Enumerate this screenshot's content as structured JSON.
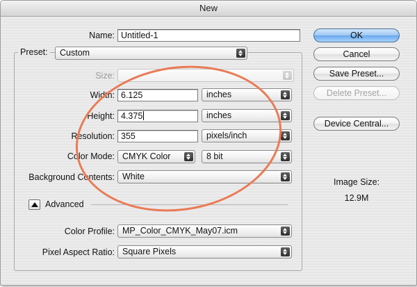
{
  "window": {
    "title": "New"
  },
  "form": {
    "name_label": "Name:",
    "name_value": "Untitled-1",
    "preset_label": "Preset:",
    "preset_value": "Custom",
    "size_label": "Size:",
    "size_value": "",
    "width_label": "Width:",
    "width_value": "6.125",
    "width_unit": "inches",
    "height_label": "Height:",
    "height_value": "4.375",
    "height_unit": "inches",
    "resolution_label": "Resolution:",
    "resolution_value": "355",
    "resolution_unit": "pixels/inch",
    "color_mode_label": "Color Mode:",
    "color_mode_value": "CMYK Color",
    "bit_depth_value": "8 bit",
    "background_label": "Background Contents:",
    "background_value": "White",
    "advanced_label": "Advanced",
    "color_profile_label": "Color Profile:",
    "color_profile_value": "MP_Color_CMYK_May07.icm",
    "pixel_aspect_label": "Pixel Aspect Ratio:",
    "pixel_aspect_value": "Square Pixels"
  },
  "buttons": {
    "ok": "OK",
    "cancel": "Cancel",
    "save_preset": "Save Preset...",
    "delete_preset": "Delete Preset...",
    "device_central": "Device Central..."
  },
  "image_size": {
    "label": "Image Size:",
    "value": "12.9M"
  },
  "colors": {
    "annotation": "#ea7a55",
    "default_button": "#6aa8ec"
  }
}
